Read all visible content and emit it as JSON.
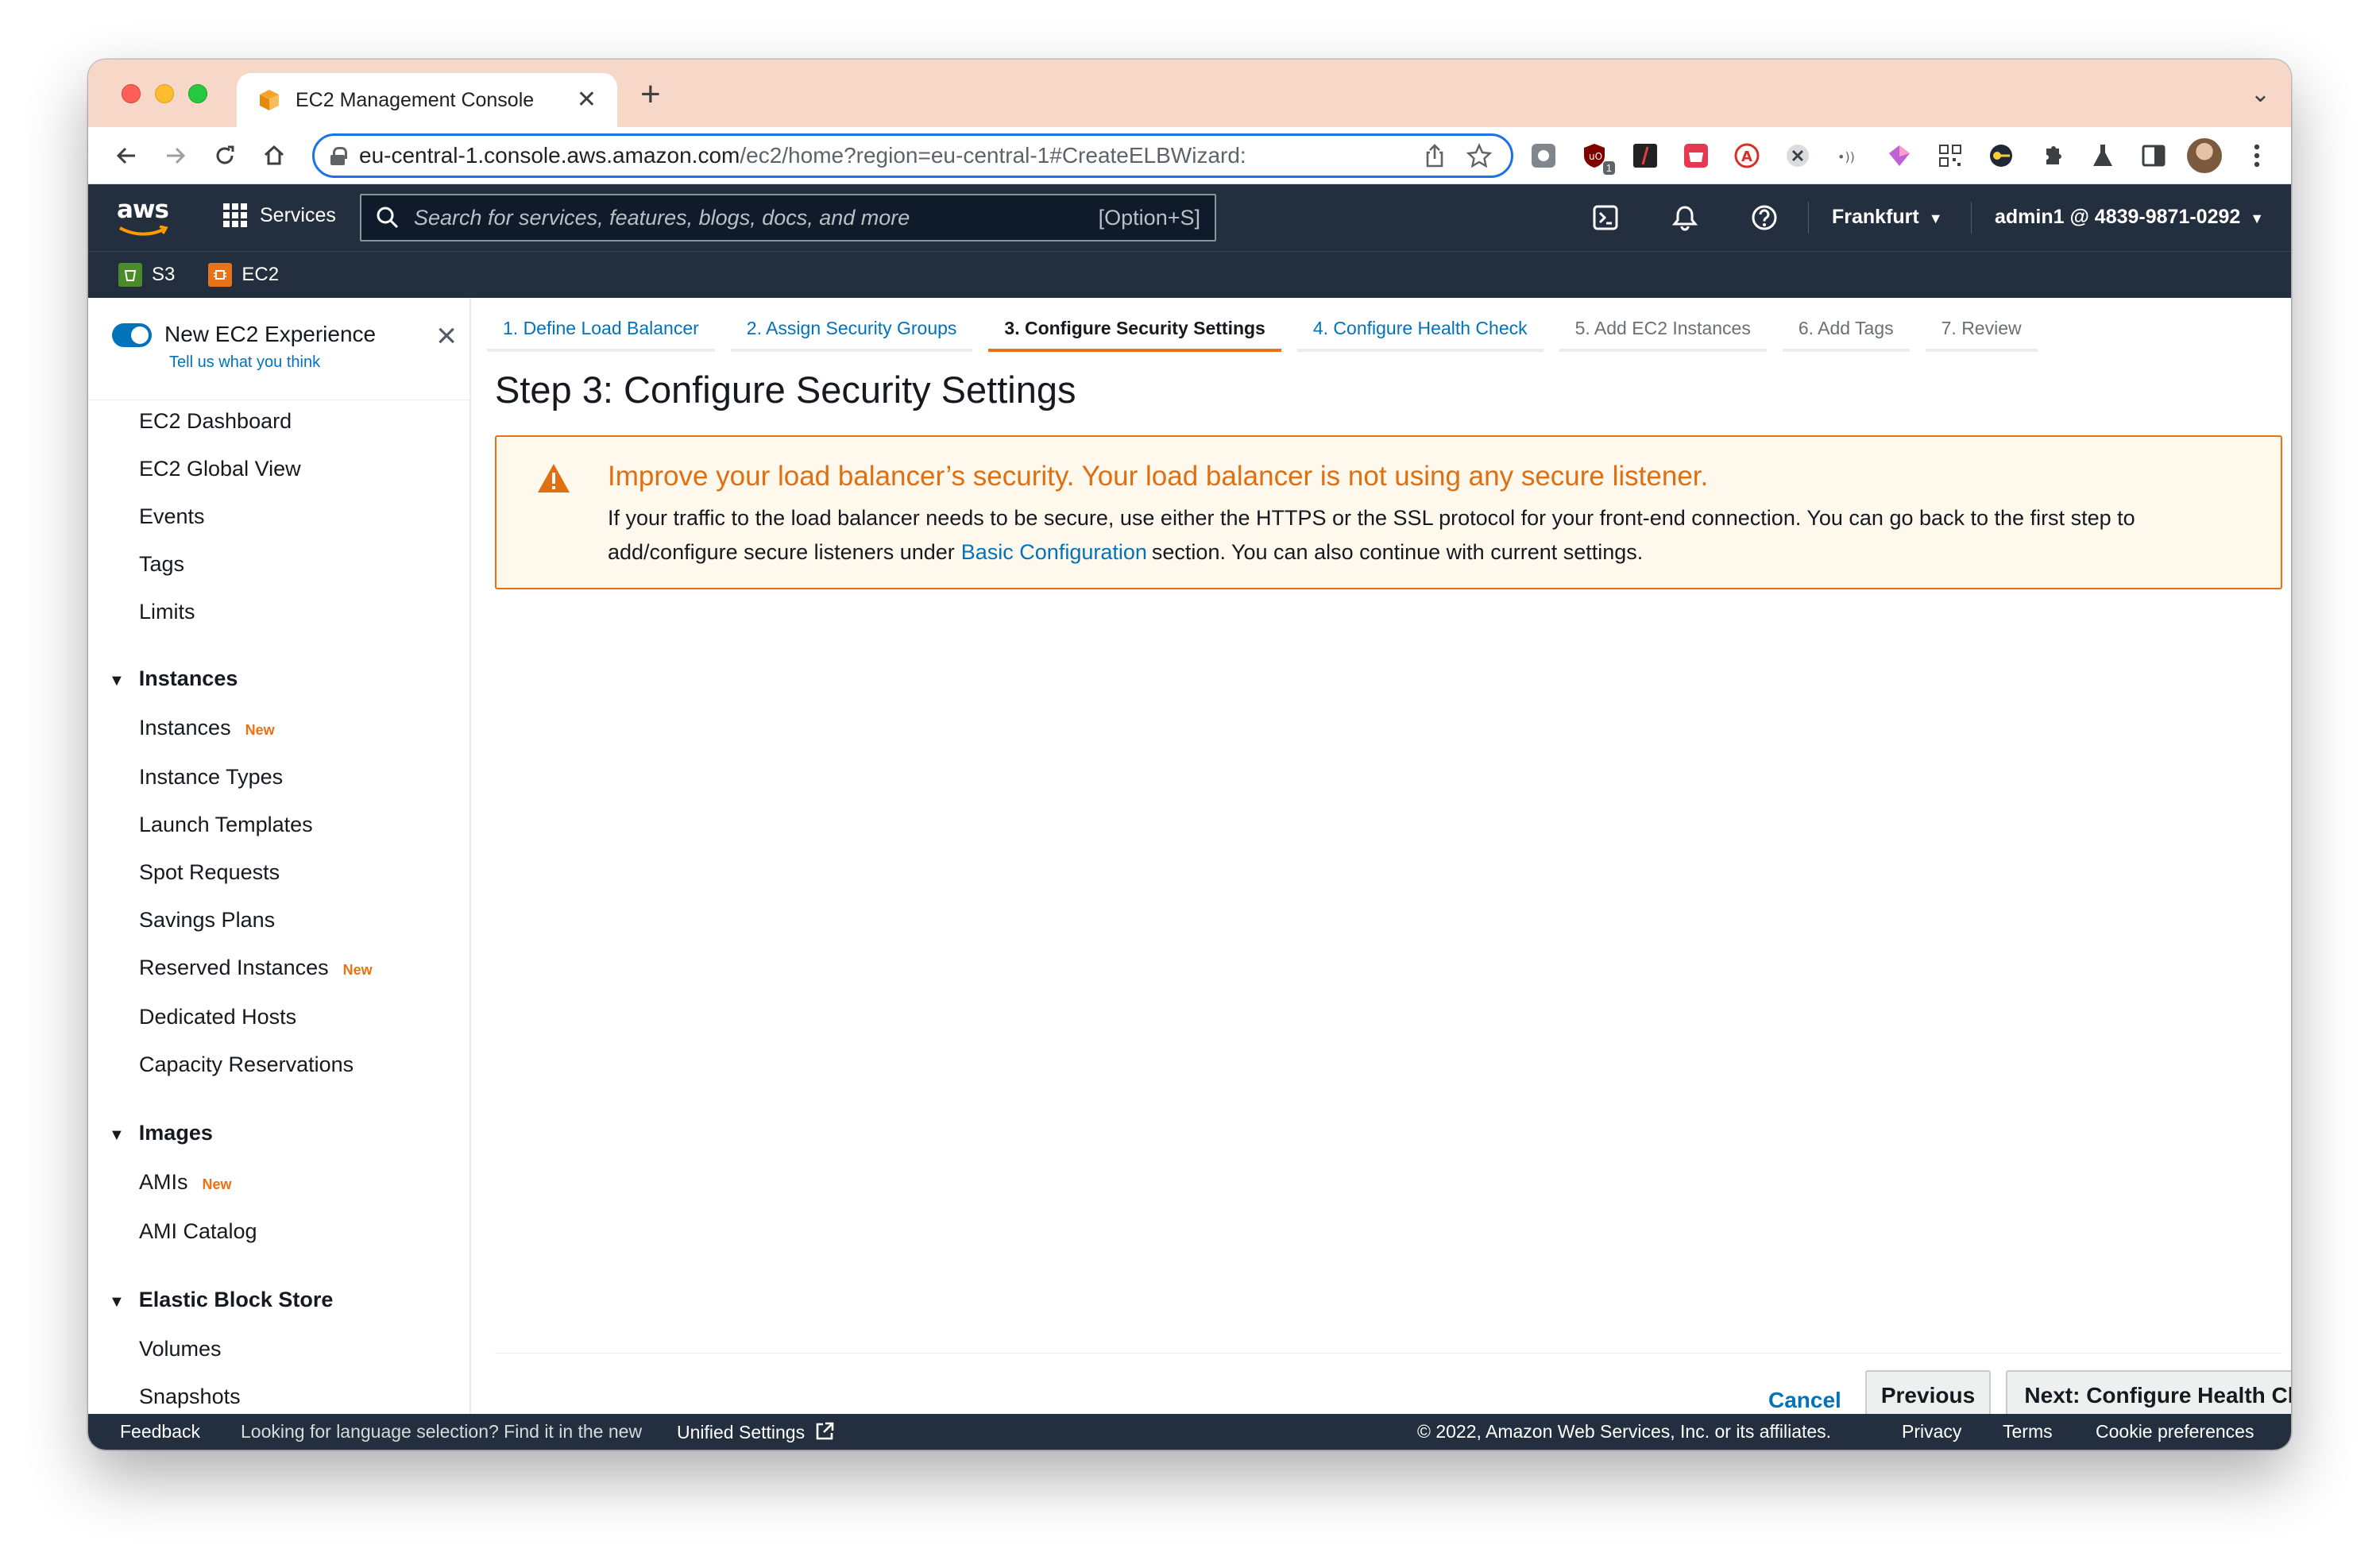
{
  "browser": {
    "tab_title": "EC2 Management Console",
    "new_tab": "+",
    "url_host": "eu-central-1.console.aws.amazon.com",
    "url_rest": "/ec2/home?region=eu-central-1#CreateELBWizard:",
    "extension_badge": "1",
    "icons": [
      "back-icon",
      "forward-icon",
      "reload-icon",
      "home-icon",
      "lock-icon",
      "share-icon",
      "star-icon",
      "extensions-icon",
      "kebab-menu-icon"
    ]
  },
  "aws": {
    "logo": "aws",
    "services_label": "Services",
    "search_placeholder": "Search for services, features, blogs, docs, and more",
    "search_shortcut": "[Option+S]",
    "region": "Frankfurt",
    "account": "admin1 @ 4839-9871-0292",
    "favorites": [
      {
        "label": "S3",
        "color": "#4b8b29"
      },
      {
        "label": "EC2",
        "color": "#e7741b"
      }
    ]
  },
  "sidebar": {
    "experience_title": "New EC2 Experience",
    "experience_link": "Tell us what you think",
    "new_badge": "New",
    "top_items": [
      "EC2 Dashboard",
      "EC2 Global View",
      "Events",
      "Tags",
      "Limits"
    ],
    "sections": [
      {
        "title": "Instances",
        "items": [
          "Instances",
          "Instance Types",
          "Launch Templates",
          "Spot Requests",
          "Savings Plans",
          "Reserved Instances",
          "Dedicated Hosts",
          "Capacity Reservations"
        ]
      },
      {
        "title": "Images",
        "items": [
          "AMIs",
          "AMI Catalog"
        ]
      },
      {
        "title": "Elastic Block Store",
        "items": [
          "Volumes",
          "Snapshots"
        ]
      }
    ]
  },
  "wizard": {
    "steps": [
      "1. Define Load Balancer",
      "2. Assign Security Groups",
      "3. Configure Security Settings",
      "4. Configure Health Check",
      "5. Add EC2 Instances",
      "6. Add Tags",
      "7. Review"
    ],
    "active_step": 3,
    "title": "Step 3: Configure Security Settings",
    "warning": {
      "heading": "Improve your load balancer’s security. Your load balancer is not using any secure listener.",
      "body_1": "If your traffic to the load balancer needs to be secure, use either the HTTPS or the SSL protocol for your front-end connection. You can go back to the first step to add/configure secure listeners under",
      "link": "Basic Configuration",
      "body_2": "section. You can also continue with current settings."
    },
    "cancel": "Cancel",
    "previous": "Previous",
    "next": "Next: Configure Health Check"
  },
  "footer": {
    "feedback": "Feedback",
    "language_note": "Looking for language selection? Find it in the new",
    "unified_settings": "Unified Settings",
    "copyright": "© 2022, Amazon Web Services, Inc. or its affiliates.",
    "privacy": "Privacy",
    "terms": "Terms",
    "cookies": "Cookie preferences"
  },
  "colors": {
    "aws_dark": "#232f3e",
    "aws_orange": "#ec7211",
    "link_blue": "#0073bb",
    "warning_bg": "#fef8ed",
    "tab_strip": "#f6d7c8"
  }
}
